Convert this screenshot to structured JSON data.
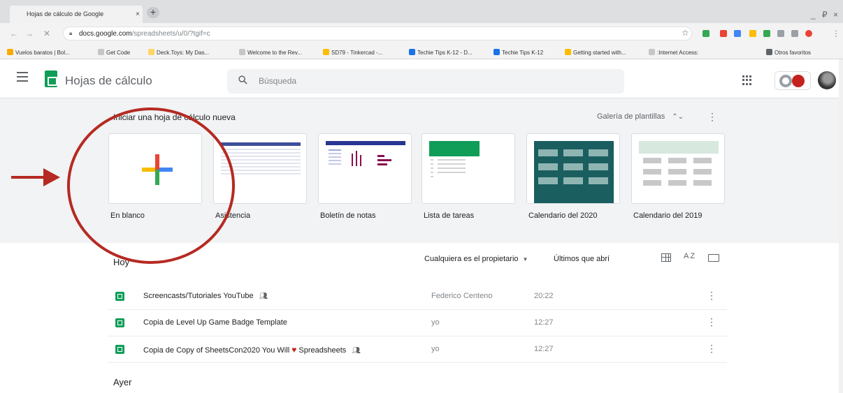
{
  "browser": {
    "tab_title": "Hojas de cálculo de Google",
    "tab_close": "×",
    "new_tab": "+",
    "url_host": "docs.google.com",
    "url_path": "/spreadsheets/u/0/?tgif=c",
    "window_minimize": "_",
    "window_restore": "₽",
    "window_close": "×",
    "bookmarks": [
      {
        "label": "Vuelos baratos | Bol...",
        "color": "#f9ab00"
      },
      {
        "label": "Get Code",
        "color": "#c6c6c6"
      },
      {
        "label": "Deck.Toys: My Das...",
        "color": "#fdd663"
      },
      {
        "label": "Welcome to the Rev...",
        "color": "#c6c6c6"
      },
      {
        "label": "SD79 - Tinkercad -...",
        "color": "#fbbc04"
      },
      {
        "label": "Techie Tips K-12 - D...",
        "color": "#1a73e8"
      },
      {
        "label": "Techie Tips K-12",
        "color": "#1a73e8"
      },
      {
        "label": "Getting started with...",
        "color": "#fbbc04"
      },
      {
        "label": ":Internet Access:",
        "color": "#c6c6c6"
      }
    ],
    "bookmarks_other": "Otros favoritos"
  },
  "header": {
    "app_title": "Hojas de cálculo",
    "search_placeholder": "Búsqueda"
  },
  "gallery": {
    "title": "Iniciar una hoja de cálculo nueva",
    "toggle_label": "Galería de plantillas",
    "templates": [
      {
        "label": "En blanco"
      },
      {
        "label": "Asistencia"
      },
      {
        "label": "Boletín de notas"
      },
      {
        "label": "Lista de tareas"
      },
      {
        "label": "Calendario del 2020"
      },
      {
        "label": "Calendario del 2019"
      }
    ]
  },
  "files": {
    "section_today": "Hoy",
    "section_yesterday": "Ayer",
    "owner_filter": "Cualquiera es el propietario",
    "last_opened": "Últimos que abrí",
    "sort_label": "AZ",
    "rows": [
      {
        "name": "Screencasts/Tutoriales YouTube",
        "shared": true,
        "owner": "Federico Centeno",
        "time": "20:22"
      },
      {
        "name": "Copia de Level Up Game Badge Template",
        "shared": false,
        "owner": "yo",
        "time": "12:27"
      },
      {
        "name_before": "Copia de Copy of SheetsCon2020 You Will",
        "name_after": "Spreadsheets",
        "shared": true,
        "owner": "yo",
        "time": "12:27"
      }
    ]
  },
  "annotation_color": "#b52a22"
}
